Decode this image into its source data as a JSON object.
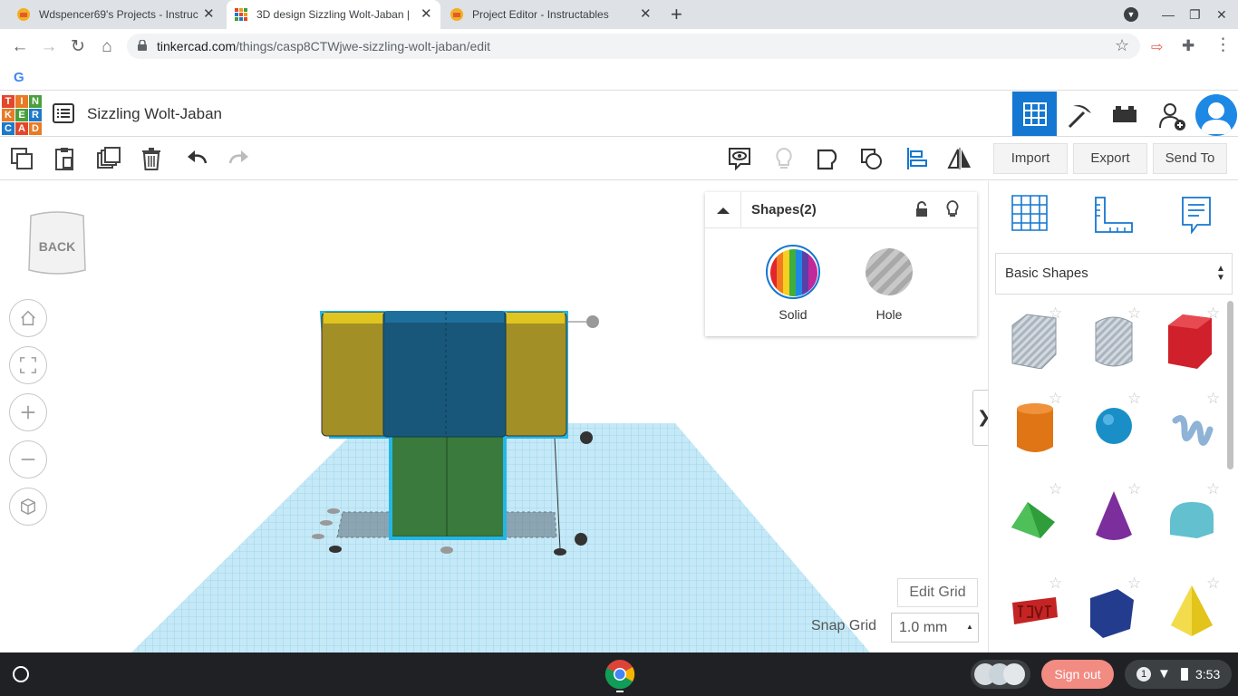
{
  "browser": {
    "tabs": [
      {
        "title": "Wdspencer69's Projects - Instruc",
        "active": false
      },
      {
        "title": "3D design Sizzling Wolt-Jaban |",
        "active": true
      },
      {
        "title": "Project Editor - Instructables",
        "active": false
      }
    ],
    "new_tab": "+",
    "url_host": "tinkercad.com",
    "url_path": "/things/casp8CTWjwe-sizzling-wolt-jaban/edit",
    "bookmark_initial": "G"
  },
  "app": {
    "logo_letters": [
      "T",
      "I",
      "N",
      "K",
      "E",
      "R",
      "C",
      "A",
      "D"
    ],
    "title": "Sizzling Wolt-Jaban",
    "toolbar": {
      "import": "Import",
      "export": "Export",
      "send_to": "Send To"
    },
    "viewcube": "BACK",
    "inspector": {
      "title": "Shapes(2)",
      "solid": "Solid",
      "hole": "Hole"
    },
    "panel": {
      "dropdown": "Basic Shapes",
      "collapse_arrow": "❯"
    },
    "edit_grid": "Edit Grid",
    "snap_grid_label": "Snap Grid",
    "snap_grid_value": "1.0 mm"
  },
  "shapes": [
    {
      "name": "box-hole",
      "color": "#b9c3cc"
    },
    {
      "name": "cylinder-hole",
      "color": "#c9cdd2"
    },
    {
      "name": "box",
      "color": "#d0202b"
    },
    {
      "name": "cylinder",
      "color": "#e07515"
    },
    {
      "name": "sphere",
      "color": "#1a8fc7"
    },
    {
      "name": "scribble",
      "color": "#8fb3d6"
    },
    {
      "name": "roof",
      "color": "#2e9d3a"
    },
    {
      "name": "cone",
      "color": "#7b2e9c"
    },
    {
      "name": "round-roof",
      "color": "#62c0cf"
    },
    {
      "name": "text",
      "color": "#c42424"
    },
    {
      "name": "box-blue",
      "color": "#233c8e"
    },
    {
      "name": "pyramid",
      "color": "#e2c41b"
    }
  ],
  "shelf": {
    "sign_out": "Sign out",
    "notif_count": "1",
    "time": "3:53"
  },
  "colors": {
    "accent_blue": "#1477d1",
    "body_yellow": "#a28f26",
    "body_blue": "#18577a",
    "body_green": "#3a7a3c",
    "grid": "#a8dcf0"
  }
}
